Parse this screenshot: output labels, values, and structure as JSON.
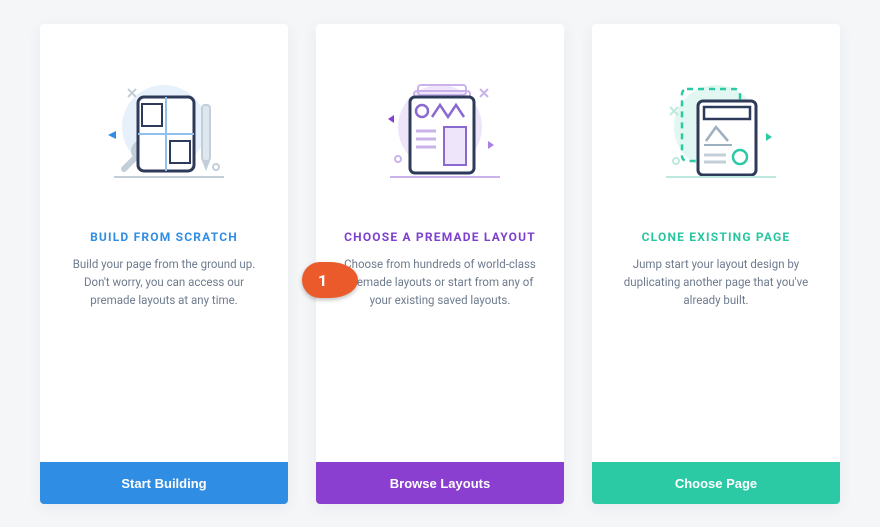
{
  "cards": [
    {
      "title": "BUILD FROM SCRATCH",
      "desc": "Build your page from the ground up. Don't worry, you can access our premade layouts at any time.",
      "button": "Start Building"
    },
    {
      "title": "CHOOSE A PREMADE LAYOUT",
      "desc": "Choose from hundreds of world-class premade layouts or start from any of your existing saved layouts.",
      "button": "Browse Layouts"
    },
    {
      "title": "CLONE EXISTING PAGE",
      "desc": "Jump start your layout design by duplicating another page that you've already built.",
      "button": "Choose Page"
    }
  ],
  "marker_label": "1",
  "colors": {
    "card1": "#2f8de4",
    "card2": "#8b3fd1",
    "card3": "#2bc9a4",
    "marker": "#eb5a2a"
  }
}
